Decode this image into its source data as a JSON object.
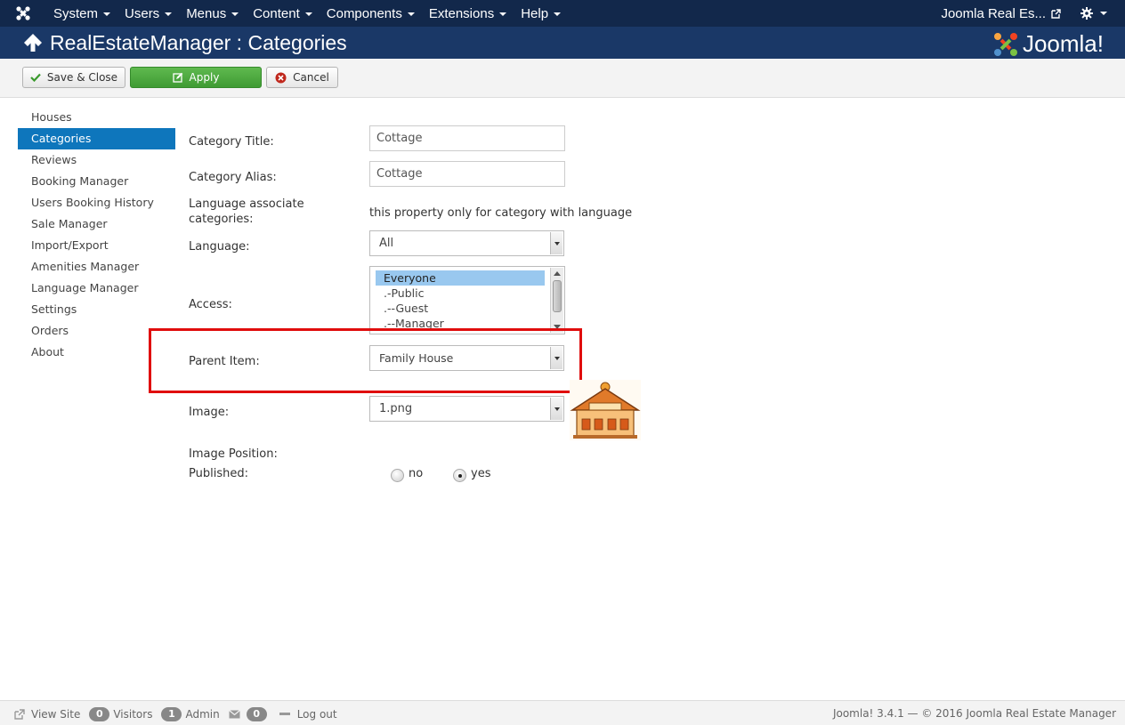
{
  "nav": {
    "menu": [
      "System",
      "Users",
      "Menus",
      "Content",
      "Components",
      "Extensions",
      "Help"
    ],
    "site_link": "Joomla Real Es..."
  },
  "header": {
    "title": "RealEstateManager : Categories",
    "logo_text": "Joomla!"
  },
  "toolbar": {
    "save_close": "Save & Close",
    "apply": "Apply",
    "cancel": "Cancel"
  },
  "sidebar": {
    "items": [
      "Houses",
      "Categories",
      "Reviews",
      "Booking Manager",
      "Users Booking History",
      "Sale Manager",
      "Import/Export",
      "Amenities Manager",
      "Language Manager",
      "Settings",
      "Orders",
      "About"
    ],
    "active": "Categories"
  },
  "form": {
    "category_title_label": "Category Title:",
    "category_title_value": "Cottage",
    "category_alias_label": "Category Alias:",
    "category_alias_value": "Cottage",
    "language_assoc_label_1": "Language associate",
    "language_assoc_label_2": "categories:",
    "language_assoc_note": "this property only for category with language",
    "language_label": "Language:",
    "language_value": "All",
    "access_label": "Access:",
    "access_options": [
      "Everyone",
      ".-Public",
      ".--Guest",
      ".--Manager"
    ],
    "access_selected": "Everyone",
    "parent_label": "Parent Item:",
    "parent_value": "Family House",
    "image_label": "Image:",
    "image_value": "1.png",
    "image_position_label": "Image Position:",
    "published_label": "Published:",
    "published_no": "no",
    "published_yes": "yes",
    "published_value": "yes"
  },
  "footer": {
    "view_site": "View Site",
    "visitors_count": "0",
    "visitors_label": "Visitors",
    "admin_count": "1",
    "admin_label": "Admin",
    "messages_count": "0",
    "logout": "Log out",
    "copyright": "Joomla! 3.4.1 — © 2016 Joomla Real Estate Manager"
  },
  "colors": {
    "navbar": "#12284b",
    "header": "#1a3867",
    "active_item": "#0e76bc",
    "apply_button": "#46a546",
    "highlight": "#e00d0d"
  }
}
